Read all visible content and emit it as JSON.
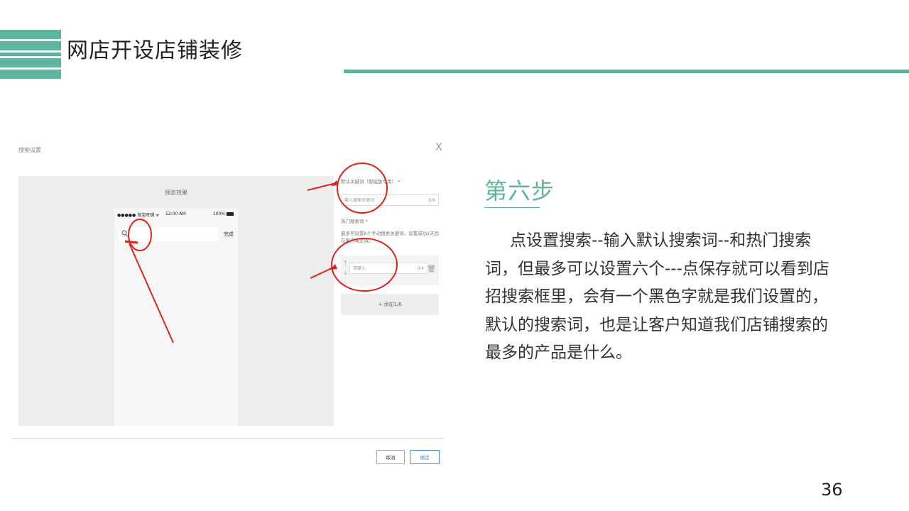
{
  "header": {
    "title": "网店开设店铺装修"
  },
  "screenshot": {
    "dialog_title": "搜索设置",
    "close_label": "X",
    "preview": {
      "title": "预览效果",
      "status_carrier": "●●●●● 淘宝旺铺 ᯤ",
      "status_time": "12:00 AM",
      "status_battery": "100%",
      "search_icon": "magnifier-icon",
      "done_label": "完成"
    },
    "form": {
      "default_keyword_label": "默认关键词（智能版专用）",
      "default_keyword_placeholder": "输入搜索关键词",
      "default_keyword_count": "0/8",
      "hot_label": "热门搜索词",
      "hot_hint": "最多可设置6个手动搜索关键词，设置成功2天后在客户端生效。",
      "hot_placeholder": "请输入",
      "hot_count": "0/4",
      "add_label": "+ 添加1/6"
    },
    "buttons": {
      "cancel": "取消",
      "ok": "确定"
    },
    "annotation_color": "#e0231a"
  },
  "content": {
    "step_title": "第六步",
    "description": "点设置搜索--输入默认搜索词--和热门搜索词，但最多可以设置六个---点保存就可以看到店招搜索框里，会有一个黑色字就是我们设置的，默认的搜索词，也是让客户知道我们店铺搜索的最多的产品是什么。"
  },
  "page_number": "36",
  "colors": {
    "accent": "#5fb49c"
  }
}
